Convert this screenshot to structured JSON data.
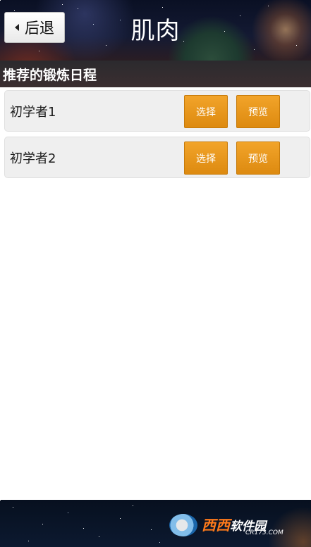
{
  "header": {
    "back_label": "后退",
    "title": "肌肉"
  },
  "section": {
    "title": "推荐的锻炼日程"
  },
  "schedules": [
    {
      "name": "初学者1",
      "select_label": "选择",
      "preview_label": "预览"
    },
    {
      "name": "初学者2",
      "select_label": "选择",
      "preview_label": "预览"
    }
  ],
  "watermark": {
    "brand": "西西",
    "brand_cn": "软件园",
    "site": "CR173.COM"
  },
  "colors": {
    "accent": "#e8951d",
    "row_bg": "#efefef"
  }
}
